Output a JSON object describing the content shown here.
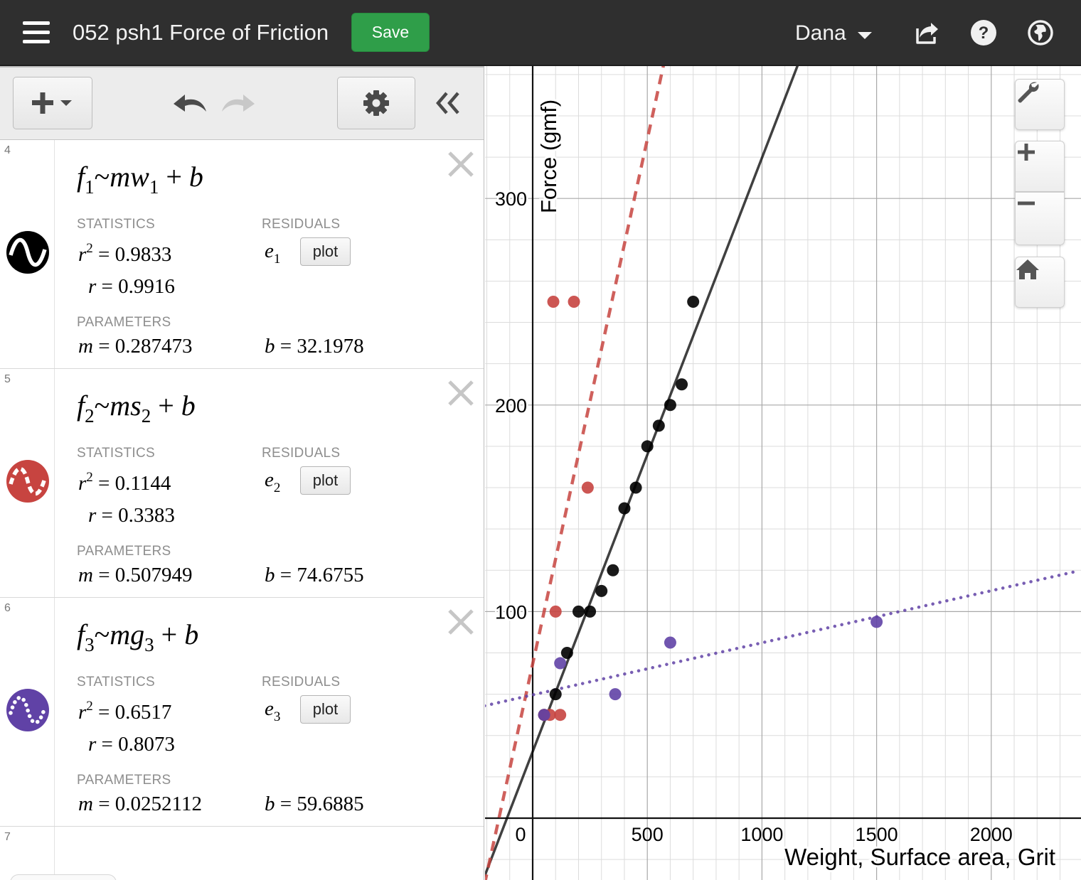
{
  "header": {
    "title": "052 psh1 Force of Friction",
    "save_label": "Save",
    "user_name": "Dana",
    "icons": [
      "menu-icon",
      "share-icon",
      "help-icon",
      "language-icon"
    ]
  },
  "toolbar": {
    "icons": [
      "add-icon",
      "undo-icon",
      "redo-icon",
      "settings-icon",
      "collapse-icon"
    ]
  },
  "expressions": [
    {
      "number": "4",
      "color": "#000000",
      "formula": {
        "lhs": "f",
        "lhs_sub": "1",
        "tilde": "~",
        "m": "m",
        "var": "w",
        "var_sub": "1",
        "plus": "+",
        "b": "b"
      },
      "statistics_label": "STATISTICS",
      "residuals_label": "RESIDUALS",
      "parameters_label": "PARAMETERS",
      "r2_sym": "r",
      "r2_sup": "2",
      "r2_value": "= 0.9833",
      "r_sym": "r",
      "r_value": "= 0.9916",
      "residual_sym": "e",
      "residual_sub": "1",
      "plot_label": "plot",
      "m_sym": "m",
      "m_value": "= 0.287473",
      "b_sym": "b",
      "b_value": "= 32.1978"
    },
    {
      "number": "5",
      "color": "#c74440",
      "formula": {
        "lhs": "f",
        "lhs_sub": "2",
        "tilde": "~",
        "m": "m",
        "var": "s",
        "var_sub": "2",
        "plus": "+",
        "b": "b"
      },
      "statistics_label": "STATISTICS",
      "residuals_label": "RESIDUALS",
      "parameters_label": "PARAMETERS",
      "r2_sym": "r",
      "r2_sup": "2",
      "r2_value": "= 0.1144",
      "r_sym": "r",
      "r_value": "= 0.3383",
      "residual_sym": "e",
      "residual_sub": "2",
      "plot_label": "plot",
      "m_sym": "m",
      "m_value": "= 0.507949",
      "b_sym": "b",
      "b_value": "= 74.6755"
    },
    {
      "number": "6",
      "color": "#6042a6",
      "formula": {
        "lhs": "f",
        "lhs_sub": "3",
        "tilde": "~",
        "m": "m",
        "var": "g",
        "var_sub": "3",
        "plus": "+",
        "b": "b"
      },
      "statistics_label": "STATISTICS",
      "residuals_label": "RESIDUALS",
      "parameters_label": "PARAMETERS",
      "r2_sym": "r",
      "r2_sup": "2",
      "r2_value": "= 0.6517",
      "r_sym": "r",
      "r_value": "= 0.8073",
      "residual_sym": "e",
      "residual_sub": "3",
      "plot_label": "plot",
      "m_sym": "m",
      "m_value": "= 0.0252112",
      "b_sym": "b",
      "b_value": "= 59.6885"
    }
  ],
  "empty_expression_number": "7",
  "graph_controls": {
    "icons": [
      "wrench-icon",
      "zoom-in-icon",
      "zoom-out-icon",
      "home-icon"
    ]
  },
  "chart_data": {
    "type": "scatter",
    "xlabel": "Weight, Surface area, Grit",
    "ylabel": "Force (gmf)",
    "xlim": [
      -210,
      2380
    ],
    "ylim": [
      -30,
      365
    ],
    "x_ticks": [
      0,
      500,
      1000,
      1500,
      2000
    ],
    "x_tick_labels": [
      "0",
      "500",
      "1000",
      "1500",
      "2000"
    ],
    "y_ticks": [
      100,
      200,
      300
    ],
    "y_tick_labels": [
      "100",
      "200",
      "300"
    ],
    "grid": true,
    "minor_grid_step_x": 100,
    "minor_grid_step_y": 20,
    "series": [
      {
        "color": "#000000",
        "points": [
          [
            50,
            50
          ],
          [
            100,
            60
          ],
          [
            150,
            80
          ],
          [
            200,
            100
          ],
          [
            250,
            100
          ],
          [
            300,
            110
          ],
          [
            350,
            120
          ],
          [
            400,
            150
          ],
          [
            450,
            160
          ],
          [
            500,
            180
          ],
          [
            550,
            190
          ],
          [
            600,
            200
          ],
          [
            650,
            210
          ],
          [
            700,
            250
          ]
        ],
        "fit": {
          "m": 0.287473,
          "b": 32.1978,
          "style": "solid"
        }
      },
      {
        "color": "#c74440",
        "points": [
          [
            50,
            50
          ],
          [
            75,
            50
          ],
          [
            120,
            50
          ],
          [
            100,
            100
          ],
          [
            90,
            250
          ],
          [
            180,
            250
          ],
          [
            240,
            160
          ]
        ],
        "fit": {
          "m": 0.507949,
          "b": 74.6755,
          "style": "dashed"
        }
      },
      {
        "color": "#6042a6",
        "points": [
          [
            50,
            50
          ],
          [
            120,
            75
          ],
          [
            360,
            60
          ],
          [
            600,
            85
          ],
          [
            1500,
            95
          ]
        ],
        "fit": {
          "m": 0.0252112,
          "b": 59.6885,
          "style": "dotted"
        }
      }
    ]
  }
}
